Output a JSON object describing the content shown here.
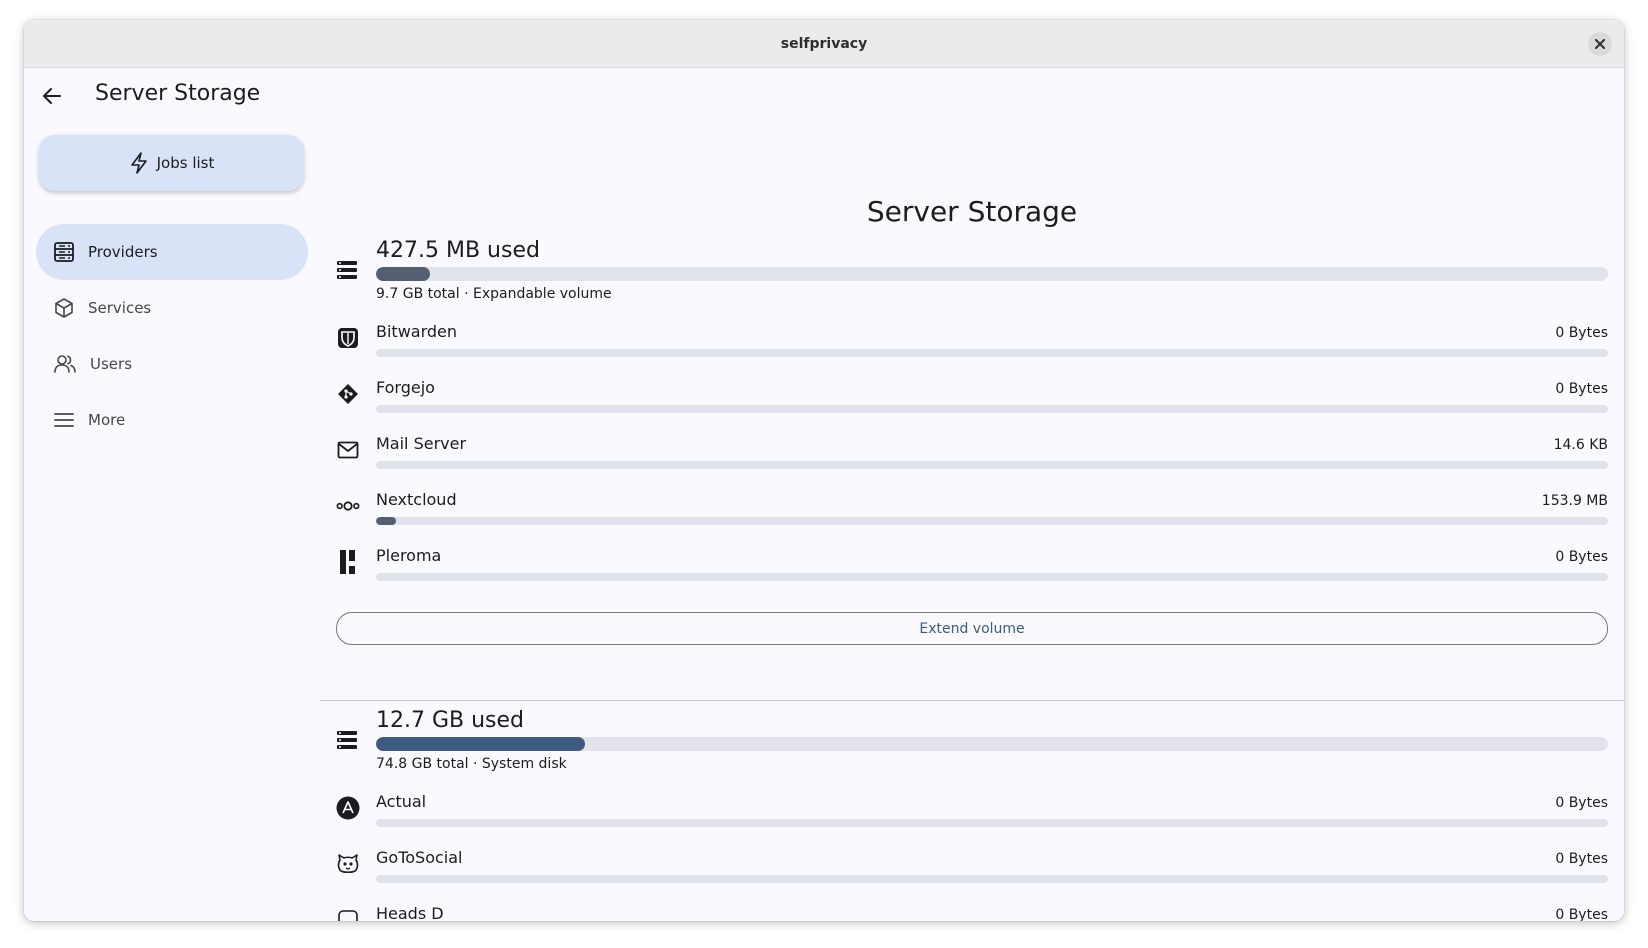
{
  "window": {
    "title": "selfprivacy"
  },
  "appbar": {
    "title": "Server Storage"
  },
  "sidebar": {
    "jobs_label": "Jobs list",
    "items": [
      {
        "label": "Providers",
        "icon": "server-icon",
        "active": true
      },
      {
        "label": "Services",
        "icon": "cube-icon",
        "active": false
      },
      {
        "label": "Users",
        "icon": "users-icon",
        "active": false
      },
      {
        "label": "More",
        "icon": "menu-icon",
        "active": false
      }
    ]
  },
  "main": {
    "title": "Server Storage",
    "volumes": [
      {
        "used": "427.5 MB used",
        "subtitle": "9.7 GB total · Expandable volume",
        "usage_fraction": 0.044,
        "bar_color": "#545f71",
        "services": [
          {
            "name": "Bitwarden",
            "size": "0 Bytes",
            "fraction": 0,
            "icon": "bitwarden-icon"
          },
          {
            "name": "Forgejo",
            "size": "0 Bytes",
            "fraction": 0,
            "icon": "forgejo-icon"
          },
          {
            "name": "Mail Server",
            "size": "14.6 KB",
            "fraction": 0,
            "icon": "mail-icon"
          },
          {
            "name": "Nextcloud",
            "size": "153.9 MB",
            "fraction": 0.016,
            "icon": "nextcloud-icon"
          },
          {
            "name": "Pleroma",
            "size": "0 Bytes",
            "fraction": 0,
            "icon": "pleroma-icon"
          }
        ],
        "extend_label": "Extend volume"
      },
      {
        "used": "12.7 GB used",
        "subtitle": "74.8 GB total · System disk",
        "usage_fraction": 0.17,
        "bar_color": "#3d5a80",
        "services": [
          {
            "name": "Actual",
            "size": "0 Bytes",
            "fraction": 0,
            "icon": "actual-icon"
          },
          {
            "name": "GoToSocial",
            "size": "0 Bytes",
            "fraction": 0,
            "icon": "gotosocial-icon"
          },
          {
            "name": "Heads D",
            "size": "0 Bytes",
            "fraction": 0,
            "icon": "service-icon"
          }
        ]
      }
    ]
  },
  "colors": {
    "accent": "#3d5a80",
    "secondary_container": "#d9e3f8",
    "track": "#e0e2ec"
  }
}
